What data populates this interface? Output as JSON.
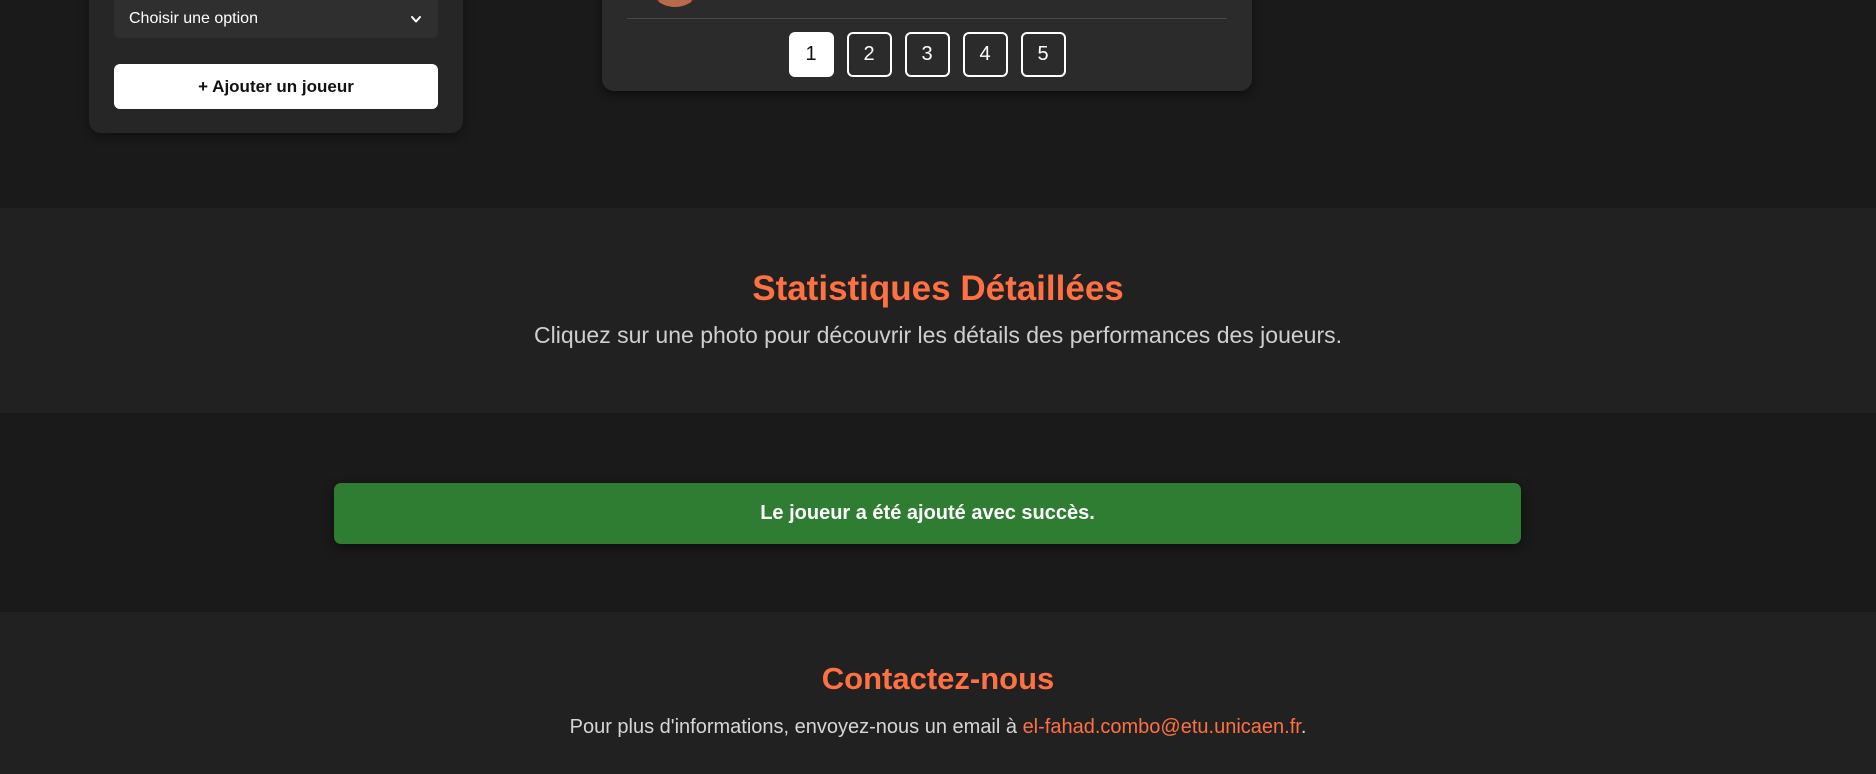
{
  "colors": {
    "accent": "#ff7043",
    "success": "#2e7d32",
    "background": "#1a1a1a",
    "section_background": "#212121"
  },
  "player_form": {
    "select": {
      "selected_value": "Choisir une option",
      "icon": "chevron-down-icon"
    },
    "add_button_label": "+ Ajouter un joueur"
  },
  "pagination": {
    "pages": [
      "1",
      "2",
      "3",
      "4",
      "5"
    ],
    "current_page": "1"
  },
  "stats": {
    "title": "Statistiques Détaillées",
    "subtitle": "Cliquez sur une photo pour découvrir les détails des performances des joueurs."
  },
  "alert": {
    "message": "Le joueur a été ajouté avec succès."
  },
  "contact": {
    "title": "Contactez-nous",
    "text_prefix": "Pour plus d'informations, envoyez-nous un email à ",
    "email": "el-fahad.combo@etu.unicaen.fr",
    "text_suffix": "."
  }
}
